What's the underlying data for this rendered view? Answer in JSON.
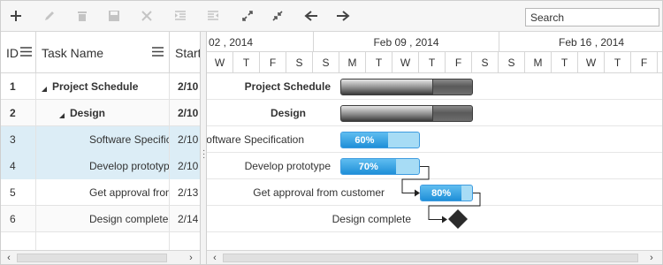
{
  "toolbar": {
    "buttons": [
      "add-icon",
      "edit-icon",
      "delete-icon",
      "save-icon",
      "cancel-icon",
      "indent-icon",
      "outdent-icon",
      "expand-all-icon",
      "collapse-all-icon",
      "previous-timespan-icon",
      "next-timespan-icon"
    ],
    "search_placeholder": "Search"
  },
  "grid": {
    "columns": {
      "id": "ID",
      "task_name": "Task Name",
      "start": "Start"
    },
    "rows": [
      {
        "id": "1",
        "name": "Project Schedule",
        "start": "2/10",
        "level": 0,
        "parent": true
      },
      {
        "id": "2",
        "name": "Design",
        "start": "2/10",
        "level": 1,
        "parent": true
      },
      {
        "id": "3",
        "name": "Software Specification",
        "start": "2/10",
        "level": 2,
        "parent": false,
        "selected": true
      },
      {
        "id": "4",
        "name": "Develop prototype",
        "start": "2/10",
        "level": 2,
        "parent": false,
        "selected": true
      },
      {
        "id": "5",
        "name": "Get approval from customer",
        "start": "2/13",
        "level": 2,
        "parent": false
      },
      {
        "id": "6",
        "name": "Design complete",
        "start": "2/14",
        "level": 2,
        "parent": false
      }
    ]
  },
  "timeline": {
    "weeks": [
      "02 , 2014",
      "Feb 09 , 2014",
      "Feb 16 , 2014"
    ],
    "days": [
      "W",
      "T",
      "F",
      "S",
      "S",
      "M",
      "T",
      "W",
      "T",
      "F",
      "S",
      "S",
      "M",
      "T",
      "W",
      "T",
      "F",
      "S"
    ]
  },
  "gantt": {
    "tasks": [
      {
        "label": "Project Schedule",
        "type": "parent",
        "progress_percent": 70
      },
      {
        "label": "Design",
        "type": "parent",
        "progress_percent": 70
      },
      {
        "label": "Software Specification",
        "type": "child",
        "progress_label": "60%",
        "progress_percent": 60
      },
      {
        "label": "Develop prototype",
        "type": "child",
        "progress_label": "70%",
        "progress_percent": 70
      },
      {
        "label": "Get approval from customer",
        "type": "child",
        "progress_label": "80%",
        "progress_percent": 80
      },
      {
        "label": "Design complete",
        "type": "milestone"
      }
    ]
  },
  "colors": {
    "accent": "#1f8fd8",
    "child_bar": "#a7dcf5",
    "parent_bar": "#5a5a5a",
    "selection": "#dcedf6"
  }
}
